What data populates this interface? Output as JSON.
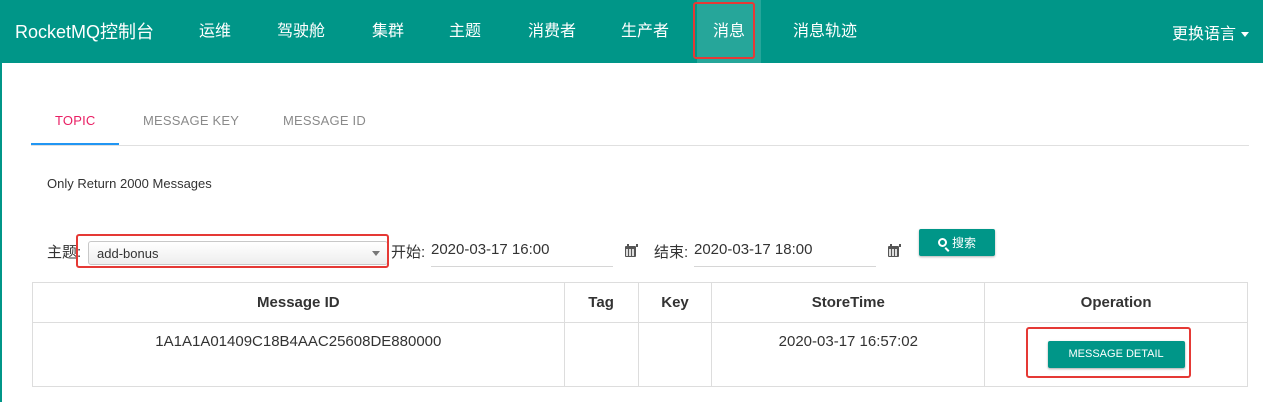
{
  "navbar": {
    "brand": "RocketMQ控制台",
    "items": [
      {
        "label": "运维"
      },
      {
        "label": "驾驶舱"
      },
      {
        "label": "集群"
      },
      {
        "label": "主题"
      },
      {
        "label": "消费者"
      },
      {
        "label": "生产者"
      },
      {
        "label": "消息",
        "active": true
      },
      {
        "label": "消息轨迹"
      }
    ],
    "language": "更换语言"
  },
  "tabs": [
    {
      "label": "TOPIC",
      "active": true
    },
    {
      "label": "MESSAGE KEY"
    },
    {
      "label": "MESSAGE ID"
    }
  ],
  "info": "Only Return 2000 Messages",
  "query": {
    "topic_label": "主题:",
    "topic_value": "add-bonus",
    "start_label": "开始:",
    "start_value": "2020-03-17 16:00",
    "end_label": "结束:",
    "end_value": "2020-03-17 18:00",
    "search_label": "搜索"
  },
  "table": {
    "headers": [
      "Message ID",
      "Tag",
      "Key",
      "StoreTime",
      "Operation"
    ],
    "rows": [
      {
        "message_id": "1A1A1A01409C18B4AAC25608DE880000",
        "tag": "",
        "key": "",
        "store_time": "2020-03-17 16:57:02",
        "operation": "MESSAGE DETAIL"
      }
    ]
  },
  "colors": {
    "primary": "#009688",
    "active_nav": "#26a69a",
    "active_tab": "#e91e63",
    "tab_indicator": "#2196f3",
    "highlight": "#e53935"
  }
}
